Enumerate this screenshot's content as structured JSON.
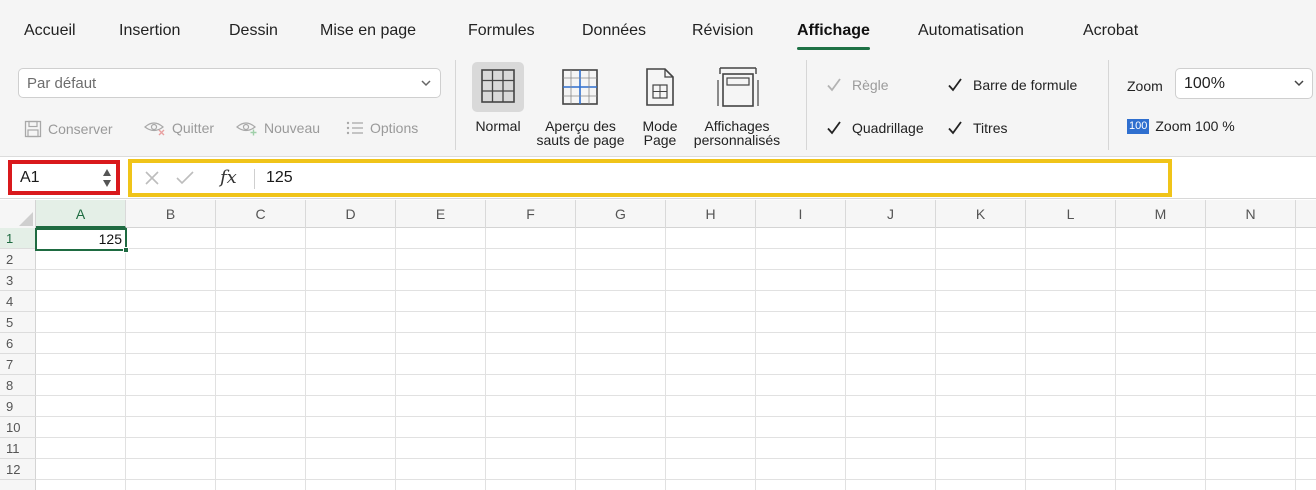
{
  "tabs": [
    {
      "label": "Accueil",
      "active": false
    },
    {
      "label": "Insertion",
      "active": false
    },
    {
      "label": "Dessin",
      "active": false
    },
    {
      "label": "Mise en page",
      "active": false
    },
    {
      "label": "Formules",
      "active": false
    },
    {
      "label": "Données",
      "active": false
    },
    {
      "label": "Révision",
      "active": false
    },
    {
      "label": "Affichage",
      "active": true
    },
    {
      "label": "Automatisation",
      "active": false
    },
    {
      "label": "Acrobat",
      "active": false
    }
  ],
  "ribbon": {
    "sheet_view": {
      "selected": "Par défaut",
      "actions": {
        "keep": "Conserver",
        "exit": "Quitter",
        "new": "Nouveau",
        "options": "Options"
      }
    },
    "workbook_views": {
      "normal": "Normal",
      "page_break_line1": "Aperçu des",
      "page_break_line2": "sauts de page",
      "page_layout_line1": "Mode",
      "page_layout_line2": "Page",
      "custom_line1": "Affichages",
      "custom_line2": "personnalisés"
    },
    "show": {
      "ruler": {
        "label": "Règle",
        "checked": true,
        "disabled": true
      },
      "formula_bar": {
        "label": "Barre de formule",
        "checked": true
      },
      "gridlines": {
        "label": "Quadrillage",
        "checked": true
      },
      "headings": {
        "label": "Titres",
        "checked": true
      }
    },
    "zoom": {
      "label": "Zoom",
      "value": "100%",
      "zoom100_badge": "100",
      "zoom100_label": "Zoom 100 %"
    }
  },
  "formula_bar": {
    "name_box": "A1",
    "fx": "fx",
    "content": "125"
  },
  "grid": {
    "columns": [
      "A",
      "B",
      "C",
      "D",
      "E",
      "F",
      "G",
      "H",
      "I",
      "J",
      "K",
      "L",
      "M",
      "N"
    ],
    "rows": [
      "1",
      "2",
      "3",
      "4",
      "5",
      "6",
      "7",
      "8",
      "9",
      "10",
      "11",
      "12"
    ],
    "selected_column": "A",
    "selected_row": "1",
    "cells": {
      "A1": "125"
    }
  },
  "colors": {
    "accent_green": "#1e6b41",
    "name_box_highlight": "#d9191c",
    "formula_highlight": "#f0c419"
  }
}
